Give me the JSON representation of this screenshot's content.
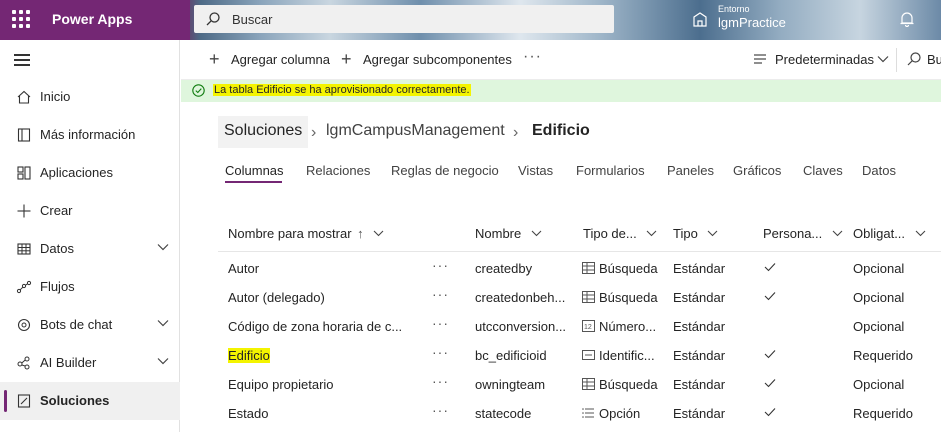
{
  "header": {
    "app_title": "Power Apps",
    "search_placeholder": "Buscar",
    "environment_label": "Entorno",
    "environment_name": "lgmPractice"
  },
  "nav": {
    "items": [
      {
        "label": "Inicio",
        "icon": "home-icon",
        "chevron": false,
        "active": false
      },
      {
        "label": "Más información",
        "icon": "book-icon",
        "chevron": false,
        "active": false
      },
      {
        "label": "Aplicaciones",
        "icon": "apps-icon",
        "chevron": false,
        "active": false
      },
      {
        "label": "Crear",
        "icon": "plus-icon",
        "chevron": false,
        "active": false
      },
      {
        "label": "Datos",
        "icon": "table-icon",
        "chevron": true,
        "active": false
      },
      {
        "label": "Flujos",
        "icon": "flow-icon",
        "chevron": false,
        "active": false
      },
      {
        "label": "Bots de chat",
        "icon": "bot-icon",
        "chevron": true,
        "active": false
      },
      {
        "label": "AI Builder",
        "icon": "ai-icon",
        "chevron": true,
        "active": false
      },
      {
        "label": "Soluciones",
        "icon": "solutions-icon",
        "chevron": false,
        "active": true
      }
    ]
  },
  "command_bar": {
    "add_column": "Agregar columna",
    "add_subcomponents": "Agregar subcomponentes",
    "view_selector": "Predeterminadas",
    "search_label": "Bu"
  },
  "notification": {
    "text": "La tabla Edificio se ha aprovisionado correctamente."
  },
  "breadcrumb": [
    "Soluciones",
    "lgmCampusManagement",
    "Edificio"
  ],
  "tabs": [
    "Columnas",
    "Relaciones",
    "Reglas de negocio",
    "Vistas",
    "Formularios",
    "Paneles",
    "Gráficos",
    "Claves",
    "Datos"
  ],
  "grid": {
    "headers": {
      "display_name": "Nombre para mostrar",
      "name": "Nombre",
      "data_type": "Tipo de...",
      "type": "Tipo",
      "customizable": "Persona...",
      "required": "Obligat..."
    },
    "rows": [
      {
        "display_name": "Autor",
        "name": "createdby",
        "data_type": "Búsqueda",
        "data_type_icon": "lookup-icon",
        "type": "Estándar",
        "customizable": true,
        "required": "Opcional"
      },
      {
        "display_name": "Autor (delegado)",
        "name": "createdonbeh...",
        "data_type": "Búsqueda",
        "data_type_icon": "lookup-icon",
        "type": "Estándar",
        "customizable": true,
        "required": "Opcional"
      },
      {
        "display_name": "Código de zona horaria de c...",
        "name": "utcconversion...",
        "data_type": "Número...",
        "data_type_icon": "number-icon",
        "type": "Estándar",
        "customizable": false,
        "required": "Opcional"
      },
      {
        "display_name": "Edificio",
        "name": "bc_edificioid",
        "data_type": "Identific...",
        "data_type_icon": "id-icon",
        "type": "Estándar",
        "customizable": true,
        "required": "Requerido"
      },
      {
        "display_name": "Equipo propietario",
        "name": "owningteam",
        "data_type": "Búsqueda",
        "data_type_icon": "lookup-icon",
        "type": "Estándar",
        "customizable": true,
        "required": "Opcional"
      },
      {
        "display_name": "Estado",
        "name": "statecode",
        "data_type": "Opción",
        "data_type_icon": "choice-icon",
        "type": "Estándar",
        "customizable": true,
        "required": "Requerido"
      }
    ]
  },
  "colors": {
    "brand": "#742774",
    "success_bg": "#dff6dd",
    "highlight": "#f4f400"
  }
}
